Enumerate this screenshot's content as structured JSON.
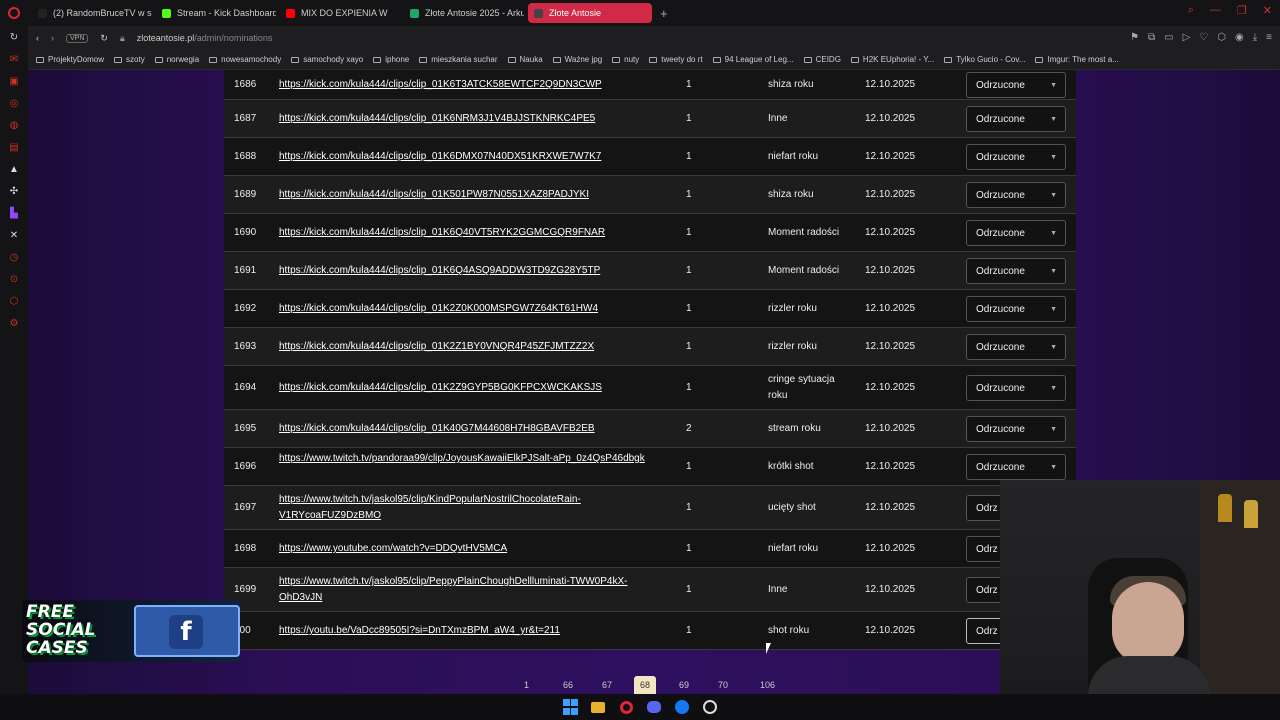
{
  "browser": {
    "tabs": [
      {
        "label": "(2) RandomBruceTV w se",
        "fav": "#222222",
        "icon": "x-icon"
      },
      {
        "label": "Stream - Kick Dashboard",
        "fav": "#53fc18",
        "icon": "kick-icon"
      },
      {
        "label": "MIX DO EXPIENIA W",
        "fav": "#ff0000",
        "icon": "youtube-icon"
      },
      {
        "label": "Złote Antosie 2025 - Arku",
        "fav": "#22a565",
        "icon": "sheets-icon"
      },
      {
        "label": "Złote Antosie",
        "fav": "#444444",
        "icon": "site-icon",
        "active": true
      }
    ],
    "address": {
      "vpn": "VPN",
      "host": "zloteantosie.pl",
      "path": "/admin/nominations"
    },
    "bookmarks": [
      "ProjektyDomow",
      "szoty",
      "norwegia",
      "nowesamochody",
      "samochody xayo",
      "iphone",
      "mieszkania suchar",
      "Nauka",
      "Ważne jpg",
      "nuty",
      "tweety do rt",
      "94 League of Leg...",
      "CEIDG",
      "H2K EUphoria! - Y...",
      "Tylko Gucio - Cov...",
      "Imgur: The most a..."
    ]
  },
  "table": {
    "rows": [
      {
        "id": "1686",
        "link": "https://kick.com/kula444/clips/clip_01K6T3ATCK58EWTCF2Q9DN3CWP",
        "count": "1",
        "category": "shiza roku",
        "date": "12.10.2025",
        "status": "Odrzucone"
      },
      {
        "id": "1687",
        "link": "https://kick.com/kula444/clips/clip_01K6NRM3J1V4BJJSTKNRKC4PE5",
        "count": "1",
        "category": "Inne",
        "date": "12.10.2025",
        "status": "Odrzucone"
      },
      {
        "id": "1688",
        "link": "https://kick.com/kula444/clips/clip_01K6DMX07N40DX51KRXWE7W7K7",
        "count": "1",
        "category": "niefart roku",
        "date": "12.10.2025",
        "status": "Odrzucone"
      },
      {
        "id": "1689",
        "link": "https://kick.com/kula444/clips/clip_01K501PW87N0551XAZ8PADJYKI",
        "count": "1",
        "category": "shiza roku",
        "date": "12.10.2025",
        "status": "Odrzucone"
      },
      {
        "id": "1690",
        "link": "https://kick.com/kula444/clips/clip_01K6Q40VT5RYK2GGMCGQR9FNAR",
        "count": "1",
        "category": "Moment radości",
        "date": "12.10.2025",
        "status": "Odrzucone"
      },
      {
        "id": "1691",
        "link": "https://kick.com/kula444/clips/clip_01K6Q4ASQ9ADDW3TD9ZG28Y5TP",
        "count": "1",
        "category": "Moment radości",
        "date": "12.10.2025",
        "status": "Odrzucone"
      },
      {
        "id": "1692",
        "link": "https://kick.com/kula444/clips/clip_01K2Z0K000MSPGW7Z64KT61HW4",
        "count": "1",
        "category": "rizzler roku",
        "date": "12.10.2025",
        "status": "Odrzucone"
      },
      {
        "id": "1693",
        "link": "https://kick.com/kula444/clips/clip_01K2Z1BY0VNQR4P45ZFJMTZZ2X",
        "count": "1",
        "category": "rizzler roku",
        "date": "12.10.2025",
        "status": "Odrzucone"
      },
      {
        "id": "1694",
        "link": "https://kick.com/kula444/clips/clip_01K2Z9GYP5BG0KFPCXWCKAKSJS",
        "count": "1",
        "category": "cringe sytuacja roku",
        "date": "12.10.2025",
        "status": "Odrzucone"
      },
      {
        "id": "1695",
        "link": "https://kick.com/kula444/clips/clip_01K40G7M44608H7H8GBAVFB2EB",
        "count": "2",
        "category": "stream roku",
        "date": "12.10.2025",
        "status": "Odrzucone"
      },
      {
        "id": "1696",
        "link": "https://www.twitch.tv/pandoraa99/clip/JoyousKawaiiElkPJSalt-aPp_0z4QsP46dbgk",
        "count": "1",
        "category": "krótki shot",
        "date": "12.10.2025",
        "status": "Odrzucone"
      },
      {
        "id": "1697",
        "link": "https://www.twitch.tv/jaskol95/clip/KindPopularNostrilChocolateRain-V1RYcoaFUZ9DzBMO",
        "count": "1",
        "category": "ucięty shot",
        "date": "12.10.2025",
        "status": "Odrz"
      },
      {
        "id": "1698",
        "link": "https://www.youtube.com/watch?v=DDQvtHV5MCA",
        "count": "1",
        "category": "niefart roku",
        "date": "12.10.2025",
        "status": "Odrz"
      },
      {
        "id": "1699",
        "link": "https://www.twitch.tv/jaskol95/clip/PeppyPlainChoughDellluminati-TWW0P4kX-OhD3vJN",
        "count": "1",
        "category": "Inne",
        "date": "12.10.2025",
        "status": "Odrz"
      },
      {
        "id": "700",
        "link": "https://youtu.be/VaDcc89505I?si=DnTXmzBPM_aW4_yr&t=211",
        "count": "1",
        "category": "shot roku",
        "date": "12.10.2025",
        "status": "Odrz"
      }
    ]
  },
  "pagination": {
    "pages": [
      "1",
      "66",
      "67",
      "68",
      "69",
      "70",
      "106"
    ],
    "current": "68"
  },
  "promo": {
    "text_line1": "FREE",
    "text_line2": "SOCIAL",
    "text_line3": "CASES",
    "fb_letter": "f"
  }
}
